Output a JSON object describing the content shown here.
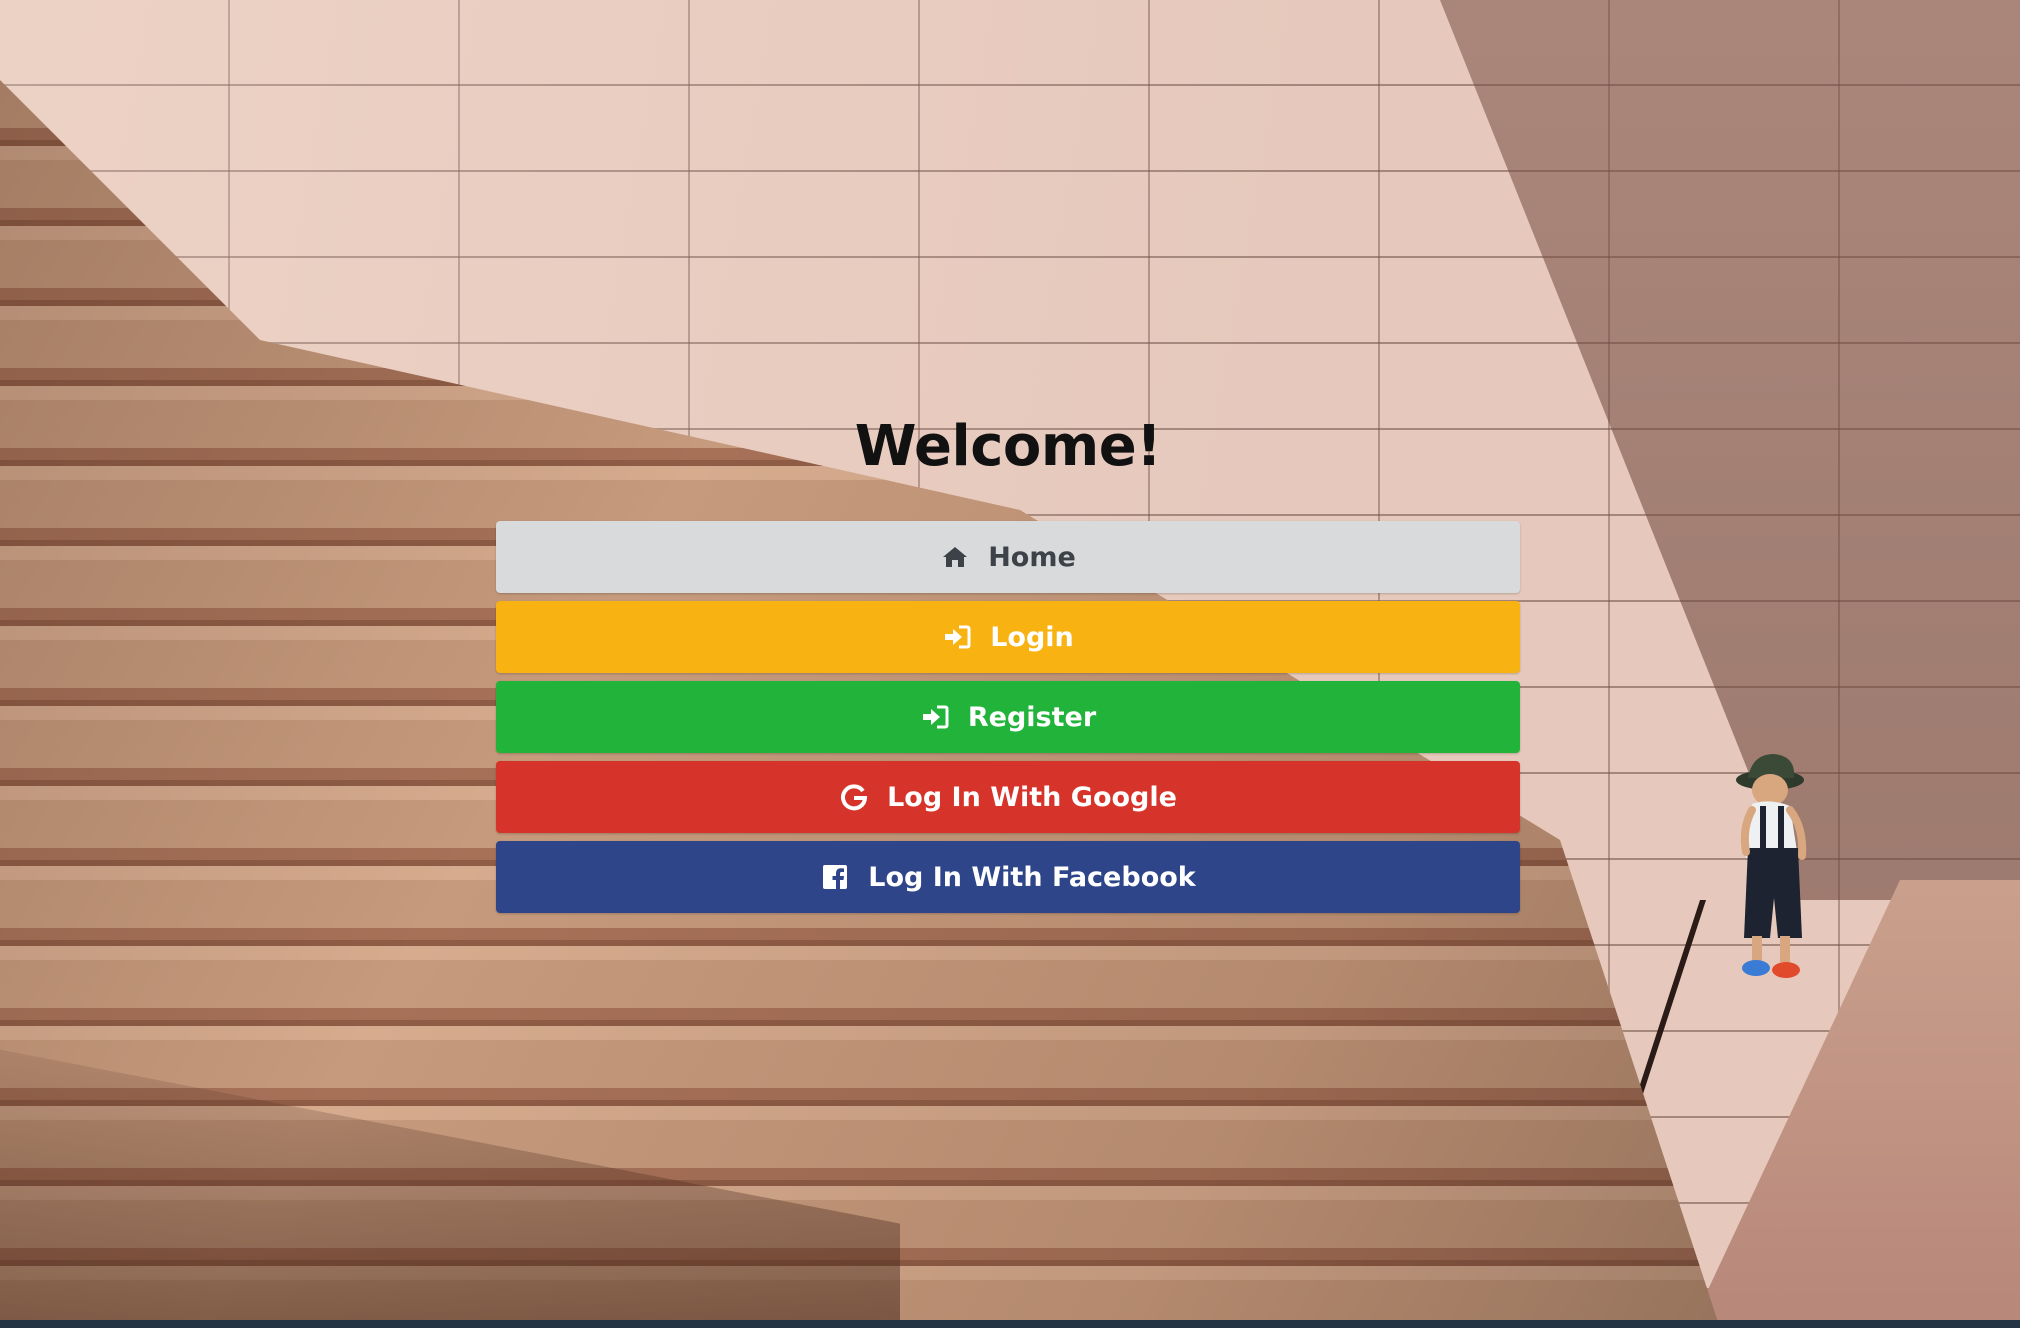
{
  "page": {
    "title": "Welcome!"
  },
  "buttons": {
    "home": {
      "label": "Home",
      "icon": "home-icon",
      "color": "#d9dadb"
    },
    "login": {
      "label": "Login",
      "icon": "sign-in-icon",
      "color": "#f8b212"
    },
    "register": {
      "label": "Register",
      "icon": "sign-in-icon",
      "color": "#22b33b"
    },
    "google": {
      "label": "Log In With Google",
      "icon": "google-icon",
      "color": "#d6342b"
    },
    "facebook": {
      "label": "Log In With Facebook",
      "icon": "facebook-icon",
      "color": "#2e4689"
    }
  }
}
